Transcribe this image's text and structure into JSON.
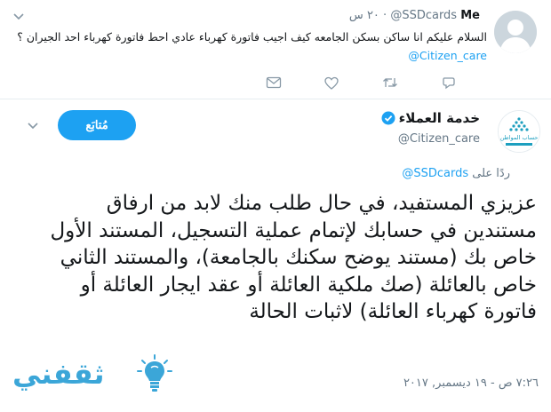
{
  "parent_tweet": {
    "author_name": "Me",
    "author_handle": "@SSDcards",
    "time": "٢٠ س",
    "text_main": "السلام عليكم انا ساكن بسكن الجامعه كيف اجيب فاتورة كهرباء عادي احط فاتورة كهرباء احد الجيران ؟",
    "mention": "@Citizen_care",
    "icons": [
      "caret-down-icon",
      "reply-icon",
      "retweet-icon",
      "like-icon",
      "direct-message-icon"
    ]
  },
  "main_tweet": {
    "author_name": "خدمة العملاء",
    "author_handle": "@Citizen_care",
    "follow_label": "مُتابَع",
    "reply_prefix": "ردًا على",
    "reply_mention": "@SSDcards",
    "body": "عزيزي المستفيد، في حال طلب منك لابد من ارفاق مستندين في حسابك لإتمام عملية التسجيل، المستند الأول خاص بك (مستند يوضح سكنك بالجامعة)، والمستند الثاني خاص بالعائلة (صك ملكية العائلة أو عقد ايجار العائلة أو فاتورة كهرباء العائلة) لاثبات الحالة",
    "timestamp": "٧:٢٦ ص - ١٩ ديسمبر, ٢٠١٧",
    "avatar_logo_text": "حساب المواطن"
  },
  "watermark": {
    "text": "ثقفني"
  },
  "colors": {
    "accent": "#1da1f2",
    "muted": "#657786",
    "text": "#14171a",
    "divider": "#e6ecf0",
    "watermark": "#3ba6d8"
  }
}
